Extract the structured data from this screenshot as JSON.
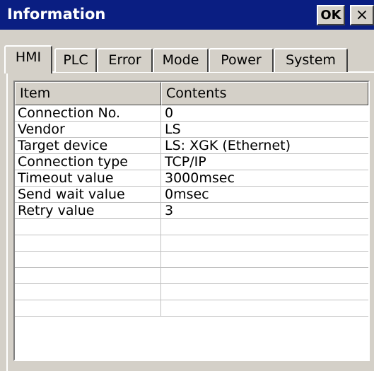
{
  "window": {
    "title": "Information",
    "ok_label": "OK",
    "close_label": "×"
  },
  "tabs": [
    {
      "label": "HMI",
      "active": true
    },
    {
      "label": "PLC",
      "active": false
    },
    {
      "label": "Error",
      "active": false
    },
    {
      "label": "Mode",
      "active": false
    },
    {
      "label": "Power",
      "active": false
    },
    {
      "label": "System",
      "active": false
    }
  ],
  "table": {
    "columns": [
      "Item",
      "Contents"
    ],
    "rows": [
      [
        "Connection No.",
        "0"
      ],
      [
        "Vendor",
        "LS"
      ],
      [
        "Target device",
        "LS: XGK (Ethernet)"
      ],
      [
        "Connection type",
        "TCP/IP"
      ],
      [
        "Timeout value",
        "3000msec"
      ],
      [
        "Send wait value",
        "0msec"
      ],
      [
        "Retry value",
        "3"
      ],
      [
        "",
        ""
      ],
      [
        "",
        ""
      ],
      [
        "",
        ""
      ],
      [
        "",
        ""
      ],
      [
        "",
        ""
      ],
      [
        "",
        ""
      ]
    ]
  },
  "colors": {
    "titlebar": "#0a1e82",
    "face": "#d4d0c8",
    "gridline": "#c0c0c0"
  }
}
